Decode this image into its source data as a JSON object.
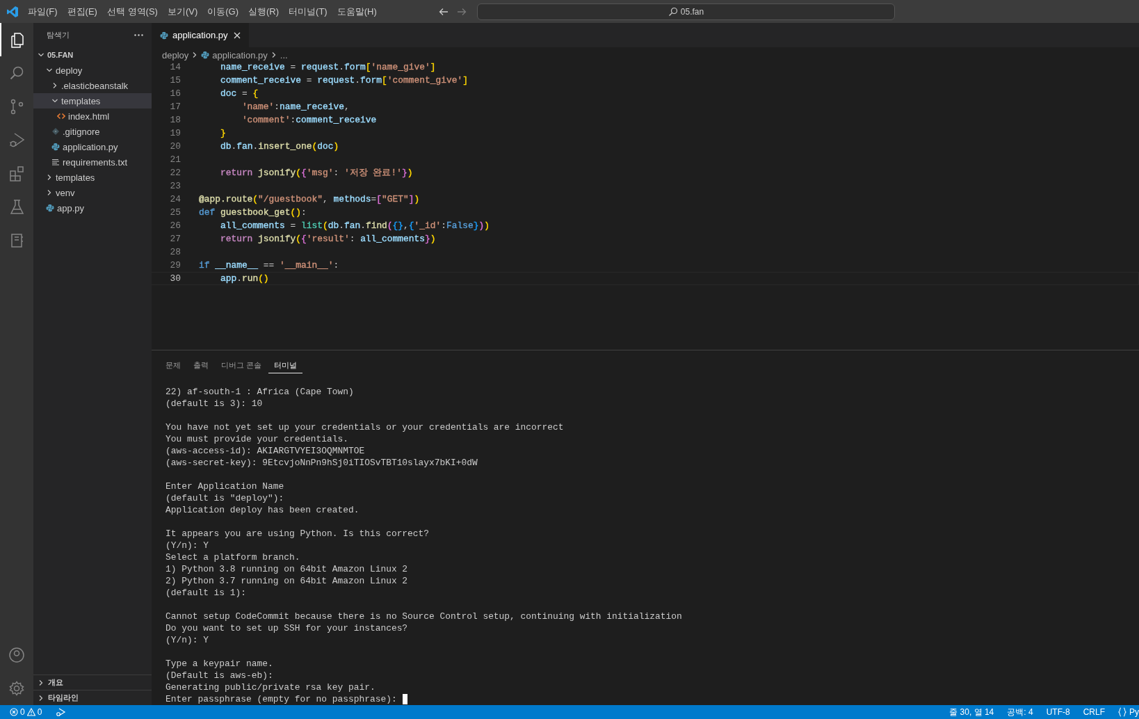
{
  "menu": [
    "파일(F)",
    "편집(E)",
    "선택 영역(S)",
    "보기(V)",
    "이동(G)",
    "실행(R)",
    "터미널(T)",
    "도움말(H)"
  ],
  "command_center": {
    "text": "05.fan"
  },
  "activity_bar": {
    "items": [
      {
        "kind": "files",
        "selected": true
      },
      {
        "kind": "search",
        "selected": false
      },
      {
        "kind": "source-control",
        "selected": false
      },
      {
        "kind": "run",
        "selected": false
      },
      {
        "kind": "extensions",
        "selected": false
      },
      {
        "kind": "testing",
        "selected": false
      },
      {
        "kind": "notebook",
        "selected": false
      }
    ],
    "bottom_items": [
      {
        "kind": "account"
      },
      {
        "kind": "settings"
      }
    ]
  },
  "explorer": {
    "title": "탐색기",
    "root": {
      "label": "05.FAN",
      "expanded": true
    },
    "tree": [
      {
        "label": "deploy",
        "kind": "folder",
        "expanded": true,
        "selected": false,
        "children": [
          {
            "label": ".elasticbeanstalk",
            "kind": "folder",
            "expanded": false,
            "selected": false
          },
          {
            "label": "templates",
            "kind": "folder",
            "expanded": true,
            "selected": true,
            "children": [
              {
                "label": "index.html",
                "kind": "html",
                "selected": false
              }
            ]
          },
          {
            "label": ".gitignore",
            "kind": "git",
            "selected": false
          },
          {
            "label": "application.py",
            "kind": "python",
            "selected": false
          },
          {
            "label": "requirements.txt",
            "kind": "text",
            "selected": false
          }
        ]
      },
      {
        "label": "templates",
        "kind": "folder",
        "expanded": false,
        "selected": false
      },
      {
        "label": "venv",
        "kind": "folder",
        "expanded": false,
        "selected": false
      },
      {
        "label": "app.py",
        "kind": "python",
        "selected": false
      }
    ],
    "sections": [
      {
        "label": "개요",
        "expanded": false
      },
      {
        "label": "타임라인",
        "expanded": false
      }
    ]
  },
  "editor": {
    "tabs": [
      {
        "label": "application.py",
        "kind": "python",
        "selected": true
      }
    ],
    "breadcrumbs": [
      {
        "label": "deploy",
        "kind": "folder"
      },
      {
        "label": "application.py",
        "kind": "python"
      },
      {
        "label": "...",
        "kind": "more"
      }
    ],
    "lines": [
      {
        "number": "14",
        "current": false,
        "tokens": [
          {
            "text": "    name_receive",
            "color": "#9cdcfe"
          },
          {
            "text": " = "
          },
          {
            "text": "request",
            "color": "#9cdcfe"
          },
          {
            "text": "."
          },
          {
            "text": "form",
            "color": "#9cdcfe"
          },
          {
            "text": "[",
            "color": "#ffd700"
          },
          {
            "text": "'name_give'",
            "color": "#ce9178"
          },
          {
            "text": "]",
            "color": "#ffd700"
          }
        ]
      },
      {
        "number": "15",
        "current": false,
        "tokens": [
          {
            "text": "    comment_receive",
            "color": "#9cdcfe"
          },
          {
            "text": " = "
          },
          {
            "text": "request",
            "color": "#9cdcfe"
          },
          {
            "text": "."
          },
          {
            "text": "form",
            "color": "#9cdcfe"
          },
          {
            "text": "[",
            "color": "#ffd700"
          },
          {
            "text": "'comment_give'",
            "color": "#ce9178"
          },
          {
            "text": "]",
            "color": "#ffd700"
          }
        ]
      },
      {
        "number": "16",
        "current": false,
        "tokens": [
          {
            "text": "    doc",
            "color": "#9cdcfe"
          },
          {
            "text": " = "
          },
          {
            "text": "{",
            "color": "#ffd700"
          }
        ]
      },
      {
        "number": "17",
        "current": false,
        "tokens": [
          {
            "text": "        'name'",
            "color": "#ce9178"
          },
          {
            "text": ":"
          },
          {
            "text": "name_receive",
            "color": "#9cdcfe"
          },
          {
            "text": ","
          }
        ]
      },
      {
        "number": "18",
        "current": false,
        "tokens": [
          {
            "text": "        'comment'",
            "color": "#ce9178"
          },
          {
            "text": ":"
          },
          {
            "text": "comment_receive",
            "color": "#9cdcfe"
          }
        ]
      },
      {
        "number": "19",
        "current": false,
        "tokens": [
          {
            "text": "    }",
            "color": "#ffd700"
          }
        ]
      },
      {
        "number": "20",
        "current": false,
        "tokens": [
          {
            "text": "    db",
            "color": "#9cdcfe"
          },
          {
            "text": "."
          },
          {
            "text": "fan",
            "color": "#9cdcfe"
          },
          {
            "text": "."
          },
          {
            "text": "insert_one",
            "color": "#dcdcaa"
          },
          {
            "text": "(",
            "color": "#ffd700"
          },
          {
            "text": "doc",
            "color": "#9cdcfe"
          },
          {
            "text": ")",
            "color": "#ffd700"
          }
        ]
      },
      {
        "number": "21",
        "current": false
      },
      {
        "number": "22",
        "current": false,
        "tokens": [
          {
            "text": "    return ",
            "color": "#c586c0"
          },
          {
            "text": "jsonify",
            "color": "#dcdcaa"
          },
          {
            "text": "(",
            "color": "#ffd700"
          },
          {
            "text": "{",
            "color": "#da70d6"
          },
          {
            "text": "'msg'",
            "color": "#ce9178"
          },
          {
            "text": ": "
          },
          {
            "text": "'저장 완료!'",
            "color": "#ce9178"
          },
          {
            "text": "}",
            "color": "#da70d6"
          },
          {
            "text": ")",
            "color": "#ffd700"
          }
        ]
      },
      {
        "number": "23",
        "current": false
      },
      {
        "number": "24",
        "current": false,
        "tokens": [
          {
            "text": "@app.route",
            "color": "#dcdcaa"
          },
          {
            "text": "(",
            "color": "#ffd700"
          },
          {
            "text": "\"/guestbook\"",
            "color": "#ce9178"
          },
          {
            "text": ", "
          },
          {
            "text": "methods",
            "color": "#9cdcfe"
          },
          {
            "text": "="
          },
          {
            "text": "[",
            "color": "#da70d6"
          },
          {
            "text": "\"GET\"",
            "color": "#ce9178"
          },
          {
            "text": "]",
            "color": "#da70d6"
          },
          {
            "text": ")",
            "color": "#ffd700"
          }
        ]
      },
      {
        "number": "25",
        "current": false,
        "tokens": [
          {
            "text": "def ",
            "color": "#569cd6"
          },
          {
            "text": "guestbook_get",
            "color": "#dcdcaa"
          },
          {
            "text": "()",
            "color": "#ffd700"
          },
          {
            "text": ":"
          }
        ]
      },
      {
        "number": "26",
        "current": false,
        "tokens": [
          {
            "text": "    all_comments",
            "color": "#9cdcfe"
          },
          {
            "text": " = "
          },
          {
            "text": "list",
            "color": "#4ec9b0"
          },
          {
            "text": "(",
            "color": "#ffd700"
          },
          {
            "text": "db",
            "color": "#9cdcfe"
          },
          {
            "text": "."
          },
          {
            "text": "fan",
            "color": "#9cdcfe"
          },
          {
            "text": "."
          },
          {
            "text": "find",
            "color": "#dcdcaa"
          },
          {
            "text": "(",
            "color": "#da70d6"
          },
          {
            "text": "{}",
            "color": "#179fff"
          },
          {
            "text": ","
          },
          {
            "text": "{",
            "color": "#179fff"
          },
          {
            "text": "'_id'",
            "color": "#ce9178"
          },
          {
            "text": ":"
          },
          {
            "text": "False",
            "color": "#569cd6"
          },
          {
            "text": "}",
            "color": "#179fff"
          },
          {
            "text": ")",
            "color": "#da70d6"
          },
          {
            "text": ")",
            "color": "#ffd700"
          }
        ]
      },
      {
        "number": "27",
        "current": false,
        "tokens": [
          {
            "text": "    return ",
            "color": "#c586c0"
          },
          {
            "text": "jsonify",
            "color": "#dcdcaa"
          },
          {
            "text": "(",
            "color": "#ffd700"
          },
          {
            "text": "{",
            "color": "#da70d6"
          },
          {
            "text": "'result'",
            "color": "#ce9178"
          },
          {
            "text": ": "
          },
          {
            "text": "all_comments",
            "color": "#9cdcfe"
          },
          {
            "text": "}",
            "color": "#da70d6"
          },
          {
            "text": ")",
            "color": "#ffd700"
          }
        ]
      },
      {
        "number": "28",
        "current": false
      },
      {
        "number": "29",
        "current": false,
        "tokens": [
          {
            "text": "if ",
            "color": "#569cd6"
          },
          {
            "text": "__name__",
            "color": "#9cdcfe"
          },
          {
            "text": " == "
          },
          {
            "text": "'__main__'",
            "color": "#ce9178"
          },
          {
            "text": ":"
          }
        ]
      },
      {
        "number": "30",
        "current": true,
        "tokens": [
          {
            "text": "    app",
            "color": "#9cdcfe"
          },
          {
            "text": "."
          },
          {
            "text": "run",
            "color": "#dcdcaa"
          },
          {
            "text": "()",
            "color": "#ffd700"
          }
        ]
      }
    ]
  },
  "panel": {
    "tabs": [
      {
        "label": "문제",
        "selected": false
      },
      {
        "label": "출력",
        "selected": false
      },
      {
        "label": "디버그 콘솔",
        "selected": false
      },
      {
        "label": "터미널",
        "selected": true
      }
    ],
    "terminal": {
      "blocks": [
        [
          "22) af-south-1 : Africa (Cape Town)",
          "(default is 3): 10"
        ],
        [
          "You have not yet set up your credentials or your credentials are incorrect",
          "You must provide your credentials.",
          "(aws-access-id): AKIARGTVYEI3OQMNMTOE",
          "(aws-secret-key): 9EtcvjoNnPn9hSj0iTIOSvTBT10slayx7bKI+0dW"
        ],
        [
          "Enter Application Name",
          "(default is \"deploy\"):",
          "Application deploy has been created."
        ],
        [
          "It appears you are using Python. Is this correct?",
          "(Y/n): Y",
          "Select a platform branch.",
          "1) Python 3.8 running on 64bit Amazon Linux 2",
          "2) Python 3.7 running on 64bit Amazon Linux 2",
          "(default is 1):"
        ],
        [
          "Cannot setup CodeCommit because there is no Source Control setup, continuing with initialization",
          "Do you want to set up SSH for your instances?",
          "(Y/n): Y"
        ],
        [
          "Type a keypair name.",
          "(Default is aws-eb):",
          "Generating public/private rsa key pair.",
          "Enter passphrase (empty for no passphrase):"
        ]
      ],
      "cursor": true
    }
  },
  "status_bar": {
    "errors": "0",
    "warnings": "0",
    "items": [
      "줄 30, 열 14",
      "공백: 4",
      "UTF-8",
      "CRLF"
    ],
    "language": "Py"
  }
}
